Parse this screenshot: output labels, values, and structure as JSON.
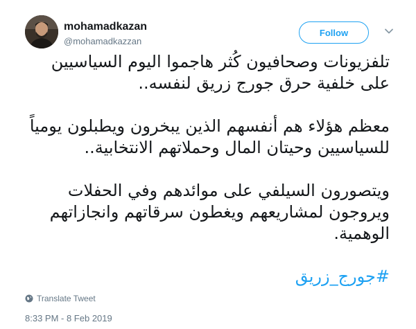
{
  "author": {
    "display_name": "mohamadkazan",
    "handle": "@mohamadkazzan"
  },
  "follow_label": "Follow",
  "tweet": {
    "paragraphs": [
      "تلفزيونات وصحافيون كُثر هاجموا اليوم السياسيين على خلفية حرق جورج زريق لنفسه..",
      "معظم هؤلاء هم أنفسهم الذين يبخرون ويطبلون يومياً للسياسيين وحيتان المال وحملاتهم الانتخابية..",
      "ويتصورون السيلفي على موائدهم وفي الحفلات ويروجون لمشاريعهم ويغطون سرقاتهم وانجازاتهم الوهمية."
    ],
    "hashtag": "#جورج_زريق"
  },
  "translate_label": "Translate Tweet",
  "timestamp": "8:33 PM - 8 Feb 2019",
  "colors": {
    "accent": "#1da1f2",
    "text": "#14171a",
    "secondary": "#657786"
  },
  "icons": {
    "avatar": "avatar",
    "menu": "chevron-down-icon",
    "translate": "globe-icon"
  }
}
